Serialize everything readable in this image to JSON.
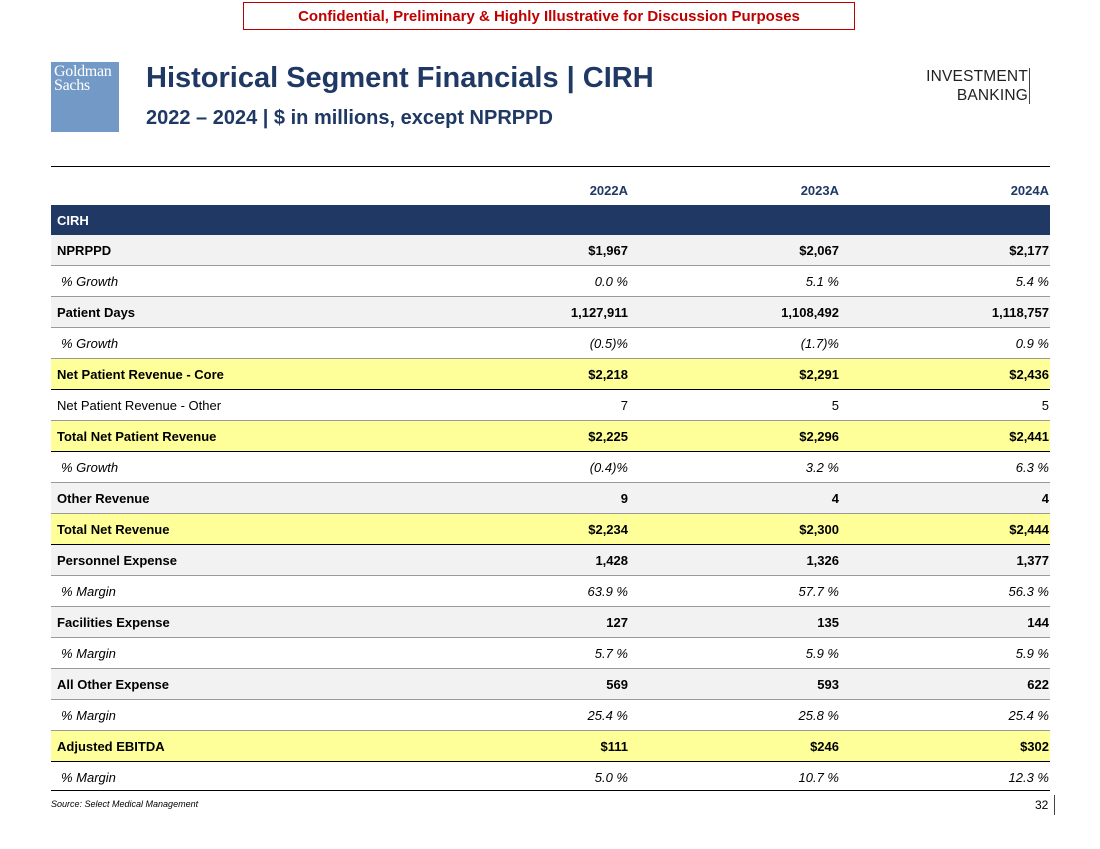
{
  "banner": "Confidential, Preliminary & Highly Illustrative for Discussion Purposes",
  "logo": {
    "line1": "Goldman",
    "line2": "Sachs"
  },
  "title": "Historical Segment Financials | CIRH",
  "subtitle": "2022 – 2024 | $ in millions, except NPRPPD",
  "brand": {
    "line1": "INVESTMENT",
    "line2": "BANKING"
  },
  "table": {
    "columns": [
      "2022A",
      "2023A",
      "2024A"
    ],
    "section": "CIRH",
    "rows": [
      {
        "label": "NPRPPD",
        "style": "bold gray",
        "values": [
          "$1,967",
          "$2,067",
          "$2,177"
        ]
      },
      {
        "label": "% Growth",
        "style": "italic",
        "values": [
          "0.0 %",
          "5.1 %",
          "5.4 %"
        ]
      },
      {
        "label": "Patient Days",
        "style": "bold gray",
        "values": [
          "1,127,911",
          "1,108,492",
          "1,118,757"
        ]
      },
      {
        "label": "% Growth",
        "style": "italic",
        "values": [
          "(0.5)%",
          "(1.7)%",
          "0.9 %"
        ]
      },
      {
        "label": "Net Patient Revenue - Core",
        "style": "bold yellow",
        "values": [
          "$2,218",
          "$2,291",
          "$2,436"
        ]
      },
      {
        "label": "Net Patient Revenue - Other",
        "style": "plain",
        "values": [
          "7",
          "5",
          "5"
        ]
      },
      {
        "label": "Total Net Patient Revenue",
        "style": "bold yellow",
        "values": [
          "$2,225",
          "$2,296",
          "$2,441"
        ]
      },
      {
        "label": "% Growth",
        "style": "italic",
        "values": [
          "(0.4)%",
          "3.2 %",
          "6.3 %"
        ]
      },
      {
        "label": "Other Revenue",
        "style": "bold gray",
        "values": [
          "9",
          "4",
          "4"
        ]
      },
      {
        "label": "Total Net Revenue",
        "style": "bold yellow",
        "values": [
          "$2,234",
          "$2,300",
          "$2,444"
        ]
      },
      {
        "label": "Personnel Expense",
        "style": "bold gray",
        "values": [
          "1,428",
          "1,326",
          "1,377"
        ]
      },
      {
        "label": "% Margin",
        "style": "italic",
        "values": [
          "63.9 %",
          "57.7 %",
          "56.3 %"
        ]
      },
      {
        "label": "Facilities Expense",
        "style": "bold gray",
        "values": [
          "127",
          "135",
          "144"
        ]
      },
      {
        "label": "% Margin",
        "style": "italic",
        "values": [
          "5.7 %",
          "5.9 %",
          "5.9 %"
        ]
      },
      {
        "label": "All Other Expense",
        "style": "bold gray",
        "values": [
          "569",
          "593",
          "622"
        ]
      },
      {
        "label": "% Margin",
        "style": "italic",
        "values": [
          "25.4 %",
          "25.8 %",
          "25.4 %"
        ]
      },
      {
        "label": "Adjusted EBITDA",
        "style": "bold yellow",
        "values": [
          "$111",
          "$246",
          "$302"
        ]
      },
      {
        "label": "% Margin",
        "style": "italic last",
        "values": [
          "5.0 %",
          "10.7 %",
          "12.3 %"
        ]
      }
    ]
  },
  "footer": {
    "source": "Source: Select Medical Management",
    "page": "32"
  }
}
